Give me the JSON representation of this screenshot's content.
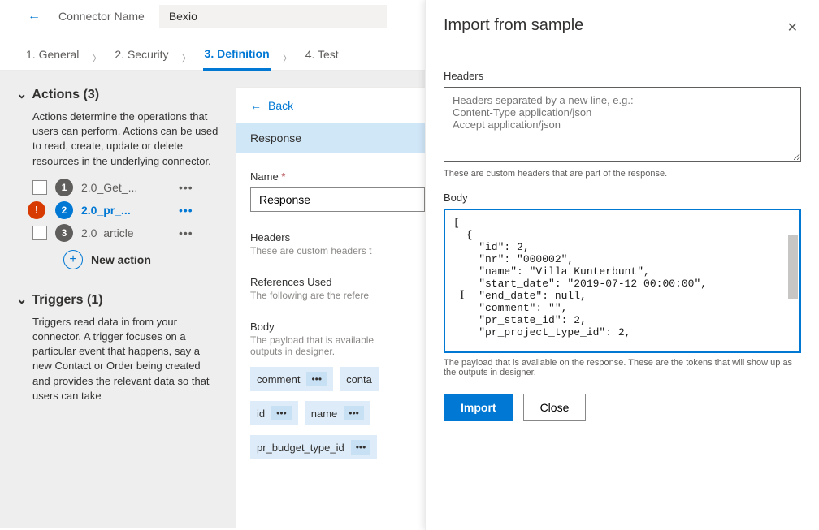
{
  "header": {
    "connector_label": "Connector Name",
    "connector_name": "Bexio"
  },
  "tabs": {
    "general": "1. General",
    "security": "2. Security",
    "definition": "3. Definition",
    "test": "4. Test"
  },
  "left": {
    "actions_header": "Actions (3)",
    "actions_desc": "Actions determine the operations that users can perform. Actions can be used to read, create, update or delete resources in the underlying connector.",
    "actions": [
      {
        "num": "1",
        "name": "2.0_Get_..."
      },
      {
        "num": "2",
        "name": "2.0_pr_..."
      },
      {
        "num": "3",
        "name": "2.0_article"
      }
    ],
    "new_action": "New action",
    "triggers_header": "Triggers (1)",
    "triggers_desc": "Triggers read data in from your connector. A trigger focuses on a particular event that happens, say a new Contact or Order being created and provides the relevant data so that users can take"
  },
  "mid": {
    "back": "Back",
    "subtab": "Response",
    "name_label": "Name",
    "name_value": "Response",
    "headers_label": "Headers",
    "headers_help": "These are custom headers t",
    "refs_label": "References Used",
    "refs_help": "The following are the refere",
    "body_label": "Body",
    "body_help": "The payload that is available\noutputs in designer.",
    "tokens_row1": [
      "comment",
      "conta"
    ],
    "tokens_row2": [
      "id",
      "name"
    ],
    "tokens_row3": [
      "pr_budget_type_id"
    ]
  },
  "panel": {
    "title": "Import from sample",
    "headers_label": "Headers",
    "headers_placeholder": "Headers separated by a new line, e.g.:\nContent-Type application/json\nAccept application/json",
    "headers_help": "These are custom headers that are part of the response.",
    "body_label": "Body",
    "body_value": "[\n  {\n    \"id\": 2,\n    \"nr\": \"000002\",\n    \"name\": \"Villa Kunterbunt\",\n    \"start_date\": \"2019-07-12 00:00:00\",\n    \"end_date\": null,\n    \"comment\": \"\",\n    \"pr_state_id\": 2,\n    \"pr_project_type_id\": 2,",
    "body_help": "The payload that is available on the response. These are the tokens that will show up as the outputs in designer.",
    "import_btn": "Import",
    "close_btn": "Close"
  }
}
